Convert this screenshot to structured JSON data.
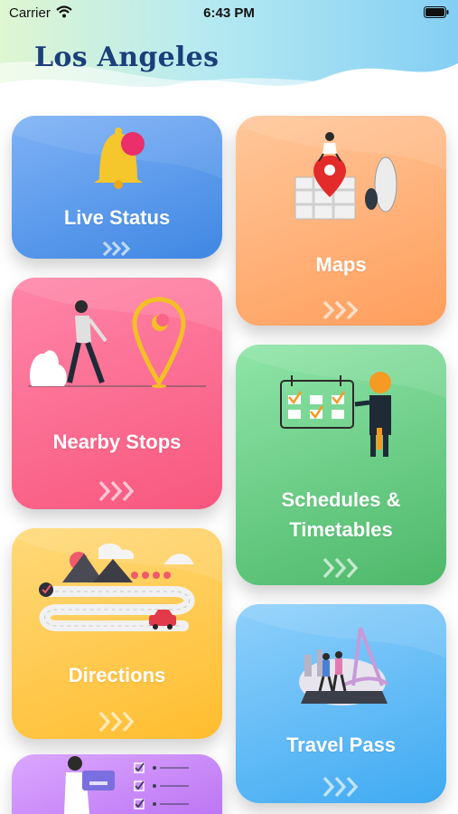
{
  "status_bar": {
    "carrier": "Carrier",
    "time": "6:43 PM"
  },
  "header": {
    "title": "Los Angeles"
  },
  "cards": {
    "live_status": {
      "label": "Live Status",
      "icon": "bell-notification-icon"
    },
    "maps": {
      "label": "Maps",
      "icon": "map-pin-illustration"
    },
    "nearby_stops": {
      "label": "Nearby Stops",
      "icon": "walking-person-pin-illustration"
    },
    "schedules": {
      "label_line1": "Schedules &",
      "label_line2": "Timetables",
      "icon": "calendar-checklist-illustration"
    },
    "directions": {
      "label": "Directions",
      "icon": "road-car-illustration"
    },
    "travel_pass": {
      "label": "Travel Pass",
      "icon": "travellers-bridge-illustration"
    },
    "payment": {
      "icon": "card-checklist-illustration"
    }
  },
  "colors": {
    "title": "#1b3f7a",
    "live_status": "#4a90e2",
    "maps": "#ffaa6a",
    "nearby_stops": "#fb6388",
    "schedules": "#5cc276",
    "directions": "#ffc940",
    "travel_pass": "#4db2f4",
    "payment": "#c47ef4"
  }
}
